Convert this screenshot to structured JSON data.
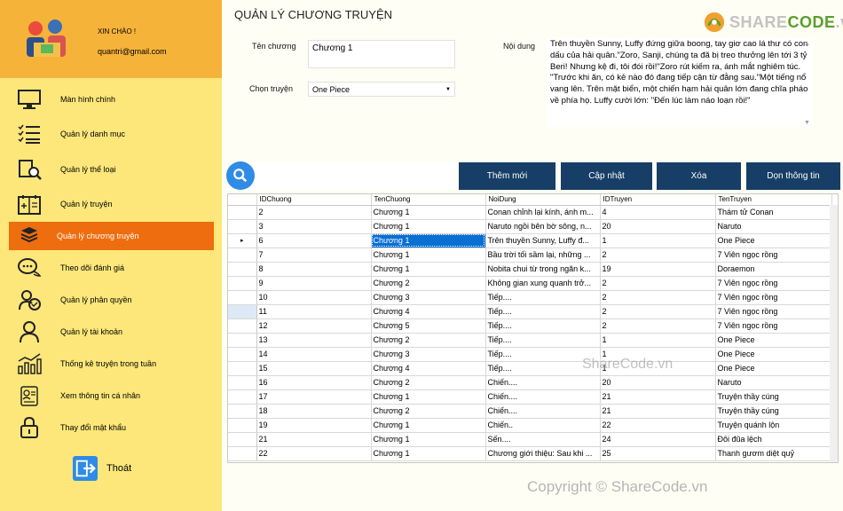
{
  "sidebar": {
    "greeting": "XIN CHÀO !",
    "email": "quantri@gmail.com",
    "items": [
      {
        "label": "Màn hình chính",
        "icon": "monitor-icon"
      },
      {
        "label": "Quản lý danh mục",
        "icon": "checklist-icon"
      },
      {
        "label": "Quản lý thể loại",
        "icon": "book-search-icon"
      },
      {
        "label": "Quản lý truyện",
        "icon": "book-add-icon"
      },
      {
        "label": "Quản lý chương truyện",
        "icon": "stack-icon"
      },
      {
        "label": "Theo dõi đánh giá",
        "icon": "chat-icon"
      },
      {
        "label": "Quản lý phân quyền",
        "icon": "shield-check-icon"
      },
      {
        "label": "Quản lý tài khoản",
        "icon": "user-icon"
      },
      {
        "label": "Thống kê truyện trong tuần",
        "icon": "chart-icon"
      },
      {
        "label": "Xem thông tin cá nhân",
        "icon": "id-card-icon"
      },
      {
        "label": "Thay đổi mật khẩu",
        "icon": "lock-icon"
      }
    ],
    "active_index": 4,
    "logout_label": "Thoát"
  },
  "main": {
    "title": "QUẢN LÝ CHƯƠNG TRUYỆN",
    "watermark_logo_a": "SHARE",
    "watermark_logo_b": "CODE",
    "watermark_logo_c": ".vn",
    "form": {
      "chapter_name_label": "Tên chương",
      "chapter_name_value": "Chương 1",
      "story_label": "Chọn truyện",
      "story_value": "One Piece",
      "content_label": "Nội dung",
      "content_value": "Trên thuyền Sunny, Luffy đứng giữa boong, tay giơ cao lá thư có con dấu của hải quân.\"Zoro, Sanji, chúng ta đã bị treo thưởng lên tới 3 tỷ Beri! Nhưng kệ đi, tôi đói rồi!\"Zoro rút kiếm ra, ánh mắt nghiêm túc. \"Trước khi ăn, có kẻ nào đó đang tiếp cận từ đằng sau.\"Một tiếng nổ vang lên. Trên mặt biển, một chiến hạm hải quân lớn đang chĩa pháo về phía họ. Luffy cười lớn: \"Đến lúc làm náo loạn rồi!\""
    },
    "buttons": {
      "add": "Thêm mới",
      "update": "Cập nhật",
      "delete": "Xóa",
      "clear": "Dọn thông tin"
    },
    "table": {
      "columns": [
        "IDChuong",
        "TenChuong",
        "NoiDung",
        "IDTruyen",
        "TenTruyen"
      ],
      "rows": [
        [
          "2",
          "Chương 1",
          "Conan chỉnh lại kính, ánh m...",
          "4",
          "Thám tử Conan"
        ],
        [
          "3",
          "Chương 1",
          "Naruto ngồi bên bờ sông, n...",
          "20",
          "Naruto"
        ],
        [
          "6",
          "Chương 1",
          "Trên thuyền Sunny, Luffy đ...",
          "1",
          "One Piece"
        ],
        [
          "7",
          "Chương 1",
          "Bầu trời tối sầm lại, những ...",
          "2",
          "7 Viên ngọc rồng"
        ],
        [
          "8",
          "Chương 1",
          "Nobita chui từ trong ngăn k...",
          "19",
          "Doraemon"
        ],
        [
          "9",
          "Chương 2",
          "Không gian xung quanh trở...",
          "2",
          "7 Viên ngọc rồng"
        ],
        [
          "10",
          "Chương 3",
          "Tiếp....",
          "2",
          "7 Viên ngọc rồng"
        ],
        [
          "11",
          "Chương 4",
          "Tiếp....",
          "2",
          "7 Viên ngọc rồng"
        ],
        [
          "12",
          "Chương 5",
          "Tiếp....",
          "2",
          "7 Viên ngọc rồng"
        ],
        [
          "13",
          "Chương 2",
          "Tiếp....",
          "1",
          "One Piece"
        ],
        [
          "14",
          "Chương 3",
          "Tiếp....",
          "1",
          "One Piece"
        ],
        [
          "15",
          "Chương 4",
          "Tiếp....",
          "1",
          "One Piece"
        ],
        [
          "16",
          "Chương 2",
          "Chiến....",
          "20",
          "Naruto"
        ],
        [
          "17",
          "Chương 1",
          "Chiến....",
          "21",
          "Truyện thầy cúng"
        ],
        [
          "18",
          "Chương 2",
          "Chiến....",
          "21",
          "Truyện thầy cúng"
        ],
        [
          "19",
          "Chương 1",
          "Chiến..",
          "22",
          "Truyện quánh lộn"
        ],
        [
          "21",
          "Chương 1",
          "Sến....",
          "24",
          "Đôi đũa lệch"
        ],
        [
          "22",
          "Chương 1",
          "Chương giới thiệu: Sau khi ...",
          "25",
          "Thanh gươm diệt quỷ"
        ]
      ],
      "selected_row": 2
    },
    "center_watermark": "ShareCode.vn",
    "footer_watermark": "Copyright © ShareCode.vn"
  }
}
